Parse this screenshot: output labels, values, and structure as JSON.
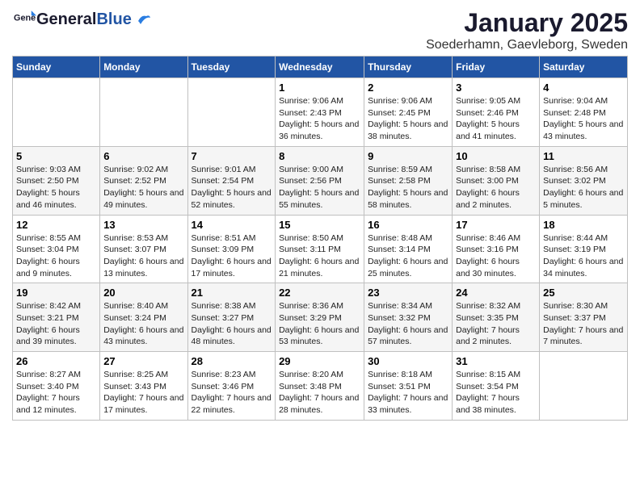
{
  "header": {
    "logo_general": "General",
    "logo_blue": "Blue",
    "title": "January 2025",
    "subtitle": "Soederhamn, Gaevleborg, Sweden"
  },
  "days_of_week": [
    "Sunday",
    "Monday",
    "Tuesday",
    "Wednesday",
    "Thursday",
    "Friday",
    "Saturday"
  ],
  "weeks": [
    [
      {
        "day": "",
        "info": ""
      },
      {
        "day": "",
        "info": ""
      },
      {
        "day": "",
        "info": ""
      },
      {
        "day": "1",
        "info": "Sunrise: 9:06 AM\nSunset: 2:43 PM\nDaylight: 5 hours and 36 minutes."
      },
      {
        "day": "2",
        "info": "Sunrise: 9:06 AM\nSunset: 2:45 PM\nDaylight: 5 hours and 38 minutes."
      },
      {
        "day": "3",
        "info": "Sunrise: 9:05 AM\nSunset: 2:46 PM\nDaylight: 5 hours and 41 minutes."
      },
      {
        "day": "4",
        "info": "Sunrise: 9:04 AM\nSunset: 2:48 PM\nDaylight: 5 hours and 43 minutes."
      }
    ],
    [
      {
        "day": "5",
        "info": "Sunrise: 9:03 AM\nSunset: 2:50 PM\nDaylight: 5 hours and 46 minutes."
      },
      {
        "day": "6",
        "info": "Sunrise: 9:02 AM\nSunset: 2:52 PM\nDaylight: 5 hours and 49 minutes."
      },
      {
        "day": "7",
        "info": "Sunrise: 9:01 AM\nSunset: 2:54 PM\nDaylight: 5 hours and 52 minutes."
      },
      {
        "day": "8",
        "info": "Sunrise: 9:00 AM\nSunset: 2:56 PM\nDaylight: 5 hours and 55 minutes."
      },
      {
        "day": "9",
        "info": "Sunrise: 8:59 AM\nSunset: 2:58 PM\nDaylight: 5 hours and 58 minutes."
      },
      {
        "day": "10",
        "info": "Sunrise: 8:58 AM\nSunset: 3:00 PM\nDaylight: 6 hours and 2 minutes."
      },
      {
        "day": "11",
        "info": "Sunrise: 8:56 AM\nSunset: 3:02 PM\nDaylight: 6 hours and 5 minutes."
      }
    ],
    [
      {
        "day": "12",
        "info": "Sunrise: 8:55 AM\nSunset: 3:04 PM\nDaylight: 6 hours and 9 minutes."
      },
      {
        "day": "13",
        "info": "Sunrise: 8:53 AM\nSunset: 3:07 PM\nDaylight: 6 hours and 13 minutes."
      },
      {
        "day": "14",
        "info": "Sunrise: 8:51 AM\nSunset: 3:09 PM\nDaylight: 6 hours and 17 minutes."
      },
      {
        "day": "15",
        "info": "Sunrise: 8:50 AM\nSunset: 3:11 PM\nDaylight: 6 hours and 21 minutes."
      },
      {
        "day": "16",
        "info": "Sunrise: 8:48 AM\nSunset: 3:14 PM\nDaylight: 6 hours and 25 minutes."
      },
      {
        "day": "17",
        "info": "Sunrise: 8:46 AM\nSunset: 3:16 PM\nDaylight: 6 hours and 30 minutes."
      },
      {
        "day": "18",
        "info": "Sunrise: 8:44 AM\nSunset: 3:19 PM\nDaylight: 6 hours and 34 minutes."
      }
    ],
    [
      {
        "day": "19",
        "info": "Sunrise: 8:42 AM\nSunset: 3:21 PM\nDaylight: 6 hours and 39 minutes."
      },
      {
        "day": "20",
        "info": "Sunrise: 8:40 AM\nSunset: 3:24 PM\nDaylight: 6 hours and 43 minutes."
      },
      {
        "day": "21",
        "info": "Sunrise: 8:38 AM\nSunset: 3:27 PM\nDaylight: 6 hours and 48 minutes."
      },
      {
        "day": "22",
        "info": "Sunrise: 8:36 AM\nSunset: 3:29 PM\nDaylight: 6 hours and 53 minutes."
      },
      {
        "day": "23",
        "info": "Sunrise: 8:34 AM\nSunset: 3:32 PM\nDaylight: 6 hours and 57 minutes."
      },
      {
        "day": "24",
        "info": "Sunrise: 8:32 AM\nSunset: 3:35 PM\nDaylight: 7 hours and 2 minutes."
      },
      {
        "day": "25",
        "info": "Sunrise: 8:30 AM\nSunset: 3:37 PM\nDaylight: 7 hours and 7 minutes."
      }
    ],
    [
      {
        "day": "26",
        "info": "Sunrise: 8:27 AM\nSunset: 3:40 PM\nDaylight: 7 hours and 12 minutes."
      },
      {
        "day": "27",
        "info": "Sunrise: 8:25 AM\nSunset: 3:43 PM\nDaylight: 7 hours and 17 minutes."
      },
      {
        "day": "28",
        "info": "Sunrise: 8:23 AM\nSunset: 3:46 PM\nDaylight: 7 hours and 22 minutes."
      },
      {
        "day": "29",
        "info": "Sunrise: 8:20 AM\nSunset: 3:48 PM\nDaylight: 7 hours and 28 minutes."
      },
      {
        "day": "30",
        "info": "Sunrise: 8:18 AM\nSunset: 3:51 PM\nDaylight: 7 hours and 33 minutes."
      },
      {
        "day": "31",
        "info": "Sunrise: 8:15 AM\nSunset: 3:54 PM\nDaylight: 7 hours and 38 minutes."
      },
      {
        "day": "",
        "info": ""
      }
    ]
  ]
}
